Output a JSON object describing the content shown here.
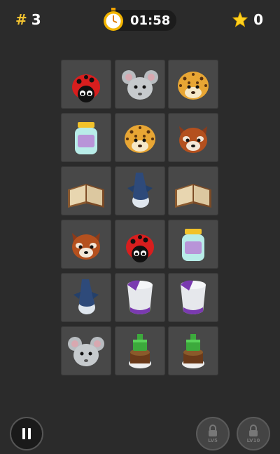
{
  "hud": {
    "level_hash": "#",
    "level_number": "3",
    "timer": "01:58",
    "score": "0"
  },
  "colors": {
    "background": "#2b2b2b",
    "tile": "#484848",
    "accent_gold": "#f2c230"
  },
  "board": {
    "rows": 6,
    "cols": 3,
    "tiles": [
      "ladybug",
      "mouse",
      "leopard",
      "jar",
      "leopard",
      "red-panda",
      "book",
      "shark",
      "book",
      "red-panda",
      "ladybug",
      "jar",
      "shark",
      "milk-carton",
      "milk-carton",
      "mouse",
      "cake",
      "cake"
    ]
  },
  "bottom_bar": {
    "pause_icon": "pause-icon",
    "locks": [
      {
        "label": "LV5"
      },
      {
        "label": "LV10"
      }
    ]
  }
}
